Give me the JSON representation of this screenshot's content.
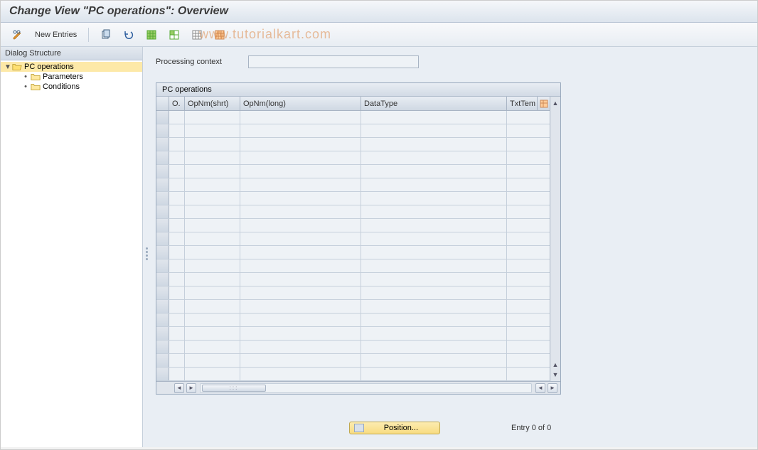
{
  "header": {
    "title": "Change View \"PC operations\": Overview"
  },
  "toolbar": {
    "new_entries_label": "New Entries"
  },
  "watermark": "www.tutorialkart.com",
  "sidebar": {
    "header": "Dialog Structure",
    "root": {
      "label": "PC operations"
    },
    "children": [
      {
        "label": "Parameters"
      },
      {
        "label": "Conditions"
      }
    ]
  },
  "content": {
    "processing_context_label": "Processing context",
    "processing_context_value": ""
  },
  "table": {
    "title": "PC operations",
    "columns": {
      "o": "O.",
      "short": "OpNm(shrt)",
      "long": "OpNm(long)",
      "type": "DataType",
      "tt": "TxtTem"
    }
  },
  "footer": {
    "position_label": "Position...",
    "entry_text": "Entry 0 of 0"
  }
}
